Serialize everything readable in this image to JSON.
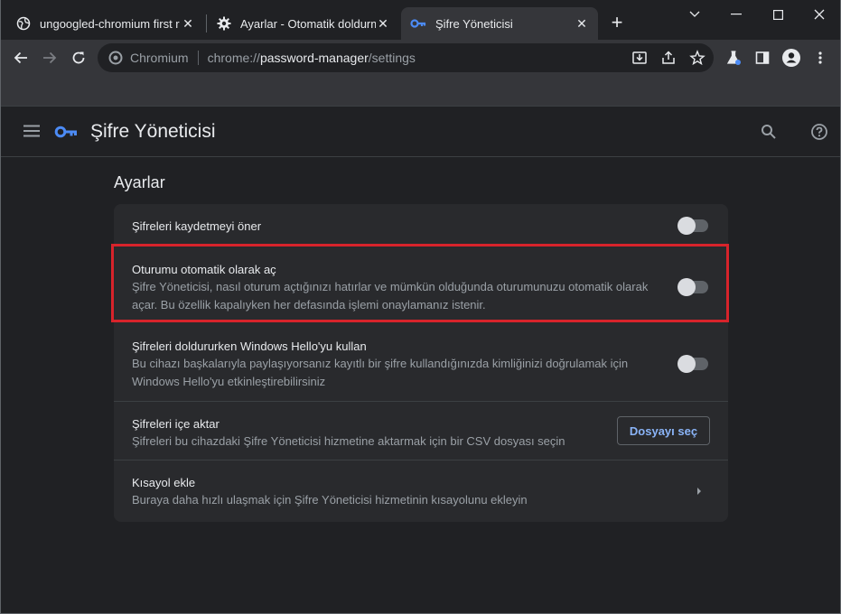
{
  "tabs": [
    {
      "label": "ungoogled-chromium first r",
      "icon": "globe-icon",
      "active": false
    },
    {
      "label": "Ayarlar - Otomatik doldurma",
      "icon": "gear-icon",
      "active": false
    },
    {
      "label": "Şifre Yöneticisi",
      "icon": "key-icon",
      "active": true
    }
  ],
  "new_tab_label": "+",
  "toolbar": {
    "site_name": "Chromium",
    "url_scheme": "chrome://",
    "url_host": "password-manager",
    "url_path": "/settings"
  },
  "header": {
    "title": "Şifre Yöneticisi"
  },
  "main": {
    "section_title": "Ayarlar",
    "rows": [
      {
        "title": "Şifreleri kaydetmeyi öner",
        "toggle_on": false
      },
      {
        "title": "Oturumu otomatik olarak aç",
        "desc": "Şifre Yöneticisi, nasıl oturum açtığınızı hatırlar ve mümkün olduğunda oturumunuzu otomatik olarak açar. Bu özellik kapalıyken her defasında işlemi onaylamanız istenir.",
        "toggle_on": false
      },
      {
        "title": "Şifreleri doldururken Windows Hello'yu kullan",
        "desc": "Bu cihazı başkalarıyla paylaşıyorsanız kayıtlı bir şifre kullandığınızda kimliğinizi doğrulamak için Windows Hello'yu etkinleştirebilirsiniz",
        "toggle_on": false
      },
      {
        "title": "Şifreleri içe aktar",
        "desc": "Şifreleri bu cihazdaki Şifre Yöneticisi hizmetine aktarmak için bir CSV dosyası seçin",
        "button": "Dosyayı seç"
      },
      {
        "title": "Kısayol ekle",
        "desc": "Buraya daha hızlı ulaşmak için Şifre Yöneticisi hizmetinin kısayolunu ekleyin"
      }
    ]
  },
  "colors": {
    "accent": "#8ab4f8",
    "key_icon": "#4c8bf5",
    "highlight": "#d7232b"
  }
}
